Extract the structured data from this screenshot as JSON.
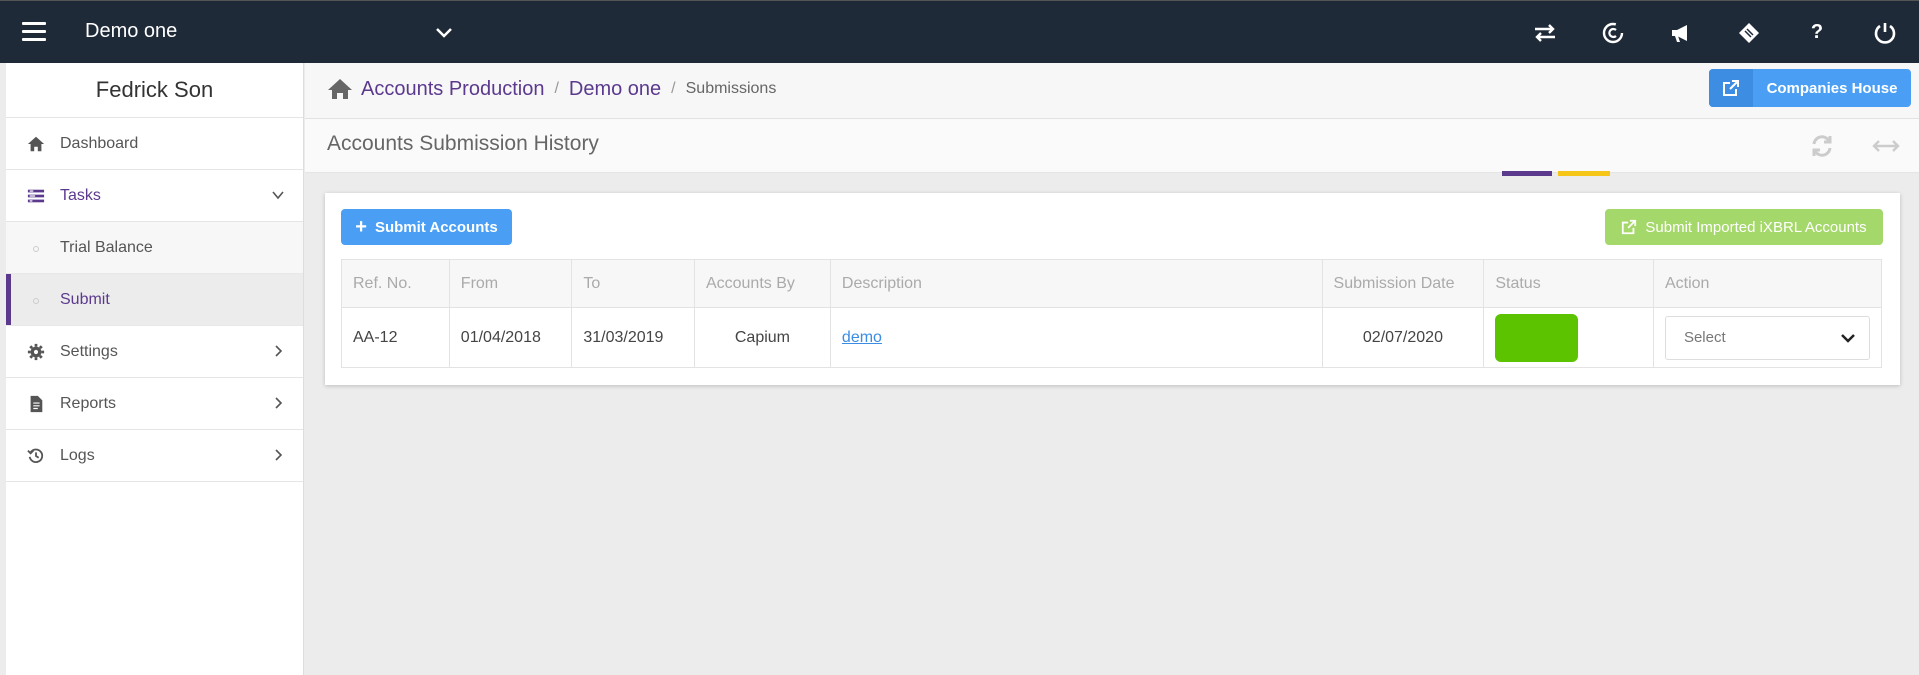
{
  "topbar": {
    "company": "Demo one",
    "icons": [
      "switch-icon",
      "capium-logo-icon",
      "megaphone-icon",
      "ticket-icon",
      "help-icon",
      "power-icon"
    ],
    "help_label": "?"
  },
  "sidebar": {
    "user": "Fedrick Son",
    "items": [
      {
        "label": "Dashboard",
        "icon": "home-icon"
      },
      {
        "label": "Tasks",
        "icon": "tasks-icon"
      },
      {
        "label": "Settings",
        "icon": "gear-icon"
      },
      {
        "label": "Reports",
        "icon": "report-icon"
      },
      {
        "label": "Logs",
        "icon": "history-icon"
      }
    ],
    "subitems": [
      {
        "label": "Trial Balance"
      },
      {
        "label": "Submit"
      }
    ]
  },
  "breadcrumb": {
    "root": "Accounts Production",
    "company": "Demo one",
    "current": "Submissions",
    "separator": "/"
  },
  "companies_house_button": "Companies House",
  "page": {
    "title": "Accounts Submission History"
  },
  "actions": {
    "submit_accounts": "Submit Accounts",
    "submit_ixbrl": "Submit Imported iXBRL Accounts"
  },
  "table": {
    "headers": [
      "Ref. No.",
      "From",
      "To",
      "Accounts By",
      "Description",
      "Submission Date",
      "Status",
      "Action"
    ],
    "rows": [
      {
        "ref": "AA-12",
        "from": "01/04/2018",
        "to": "31/03/2019",
        "accounts_by": "Capium",
        "description": "demo",
        "submission_date": "02/07/2020",
        "status_color": "#5bc300",
        "action_value": "Select"
      }
    ]
  },
  "colors": {
    "topbar": "#1f2a38",
    "accent_purple": "#5b3a8e",
    "primary_blue": "#4a9ff5",
    "accent_green": "#a5d86a",
    "accent_yellow": "#f5c518"
  }
}
